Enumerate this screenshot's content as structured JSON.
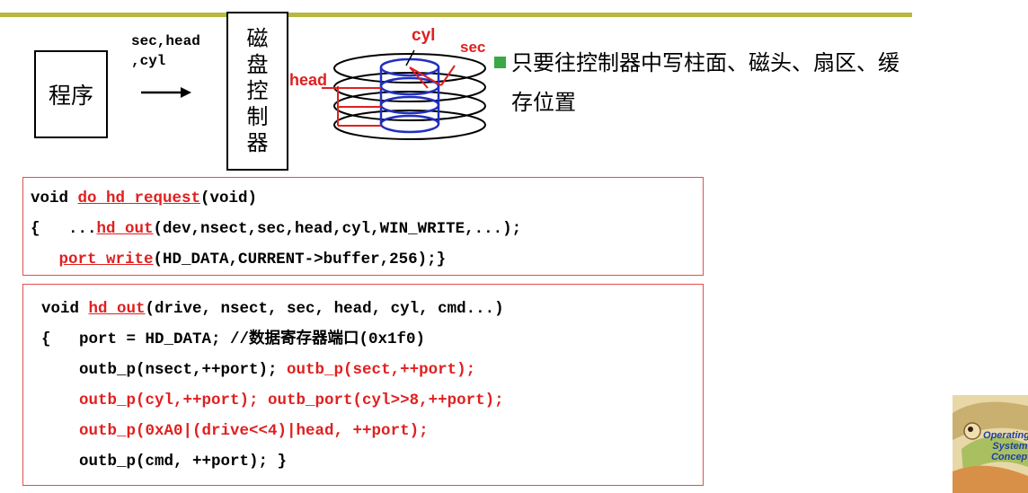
{
  "diagram": {
    "program_label": "程序",
    "params_line1": "sec,head",
    "params_line2": ",cyl",
    "controller_chars": [
      "磁",
      "盘",
      "控",
      "制",
      "器"
    ],
    "disk_labels": {
      "cyl": "cyl",
      "sec": "sec",
      "head": "head"
    }
  },
  "bullet": {
    "line1": "只要往控制器中写柱面、磁头、扇区、缓",
    "line2": "存位置"
  },
  "code1": {
    "l1_kw": "void ",
    "l1_fn": "do_hd_request",
    "l1_rest": "(void)",
    "l2_pre": "{   ...",
    "l2_fn": "hd_out",
    "l2_rest": "(dev,nsect,sec,head,cyl,WIN_WRITE,...);",
    "l3_pre": "   ",
    "l3_fn": "port_write",
    "l3_rest": "(HD_DATA,CURRENT->buffer,256);}"
  },
  "code2": {
    "l1_kw": "void ",
    "l1_fn": "hd_out",
    "l1_rest": "(drive, nsect, sec, head, cyl, cmd...)",
    "l2": "{   port = HD_DATA; //数据寄存器端口(0x1f0)",
    "l3_black": "    outb_p(nsect,++port); ",
    "l3_red": "outb_p(sect,++port);",
    "l4": "    outb_p(cyl,++port); outb_port(cyl>>8,++port);",
    "l5": "    outb_p(0xA0|(drive<<4)|head, ++port);",
    "l6": "    outb_p(cmd, ++port); }"
  },
  "logo": {
    "line1": "Operating",
    "line2": "System",
    "line3": "Concepts"
  },
  "colors": {
    "accent_bar": "#b8b840",
    "code_red": "#e02020",
    "bullet_green": "#3aa844",
    "disk_blue": "#2030c0"
  }
}
